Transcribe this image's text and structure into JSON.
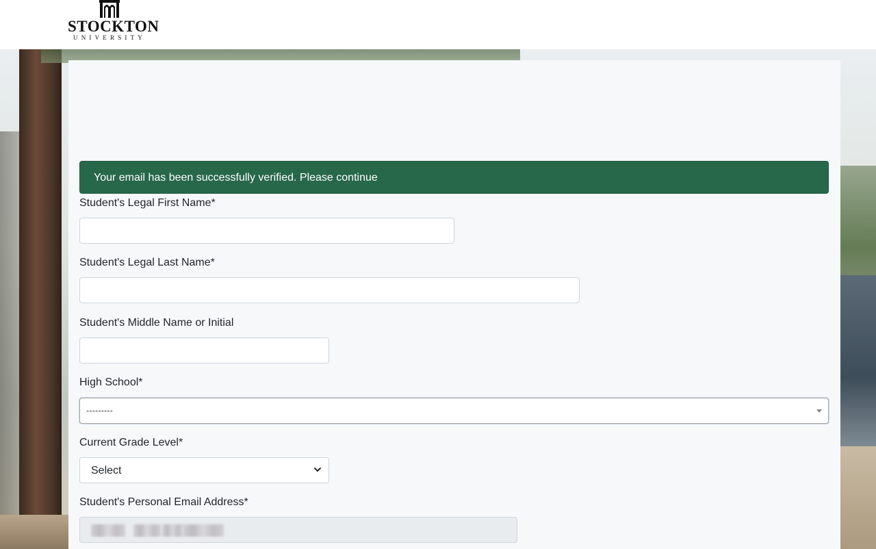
{
  "header": {
    "logo_word": "STOCKTON",
    "logo_sub": "UNIVERSITY"
  },
  "alert": {
    "message": "Your email has been successfully verified. Please continue",
    "color": "#27674a"
  },
  "form": {
    "first_name": {
      "label": "Student's Legal First Name*",
      "value": ""
    },
    "last_name": {
      "label": "Student's Legal Last Name*",
      "value": ""
    },
    "middle_name": {
      "label": "Student's Middle Name or Initial",
      "value": ""
    },
    "high_school": {
      "label": "High School*",
      "selected": "---------"
    },
    "grade_level": {
      "label": "Current Grade Level*",
      "selected": "Select"
    },
    "email": {
      "label": "Student's Personal Email Address*",
      "value": ""
    }
  }
}
